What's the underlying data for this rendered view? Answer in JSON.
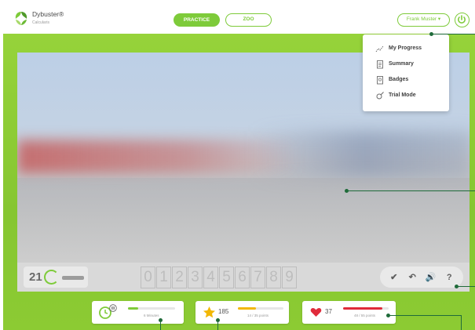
{
  "header": {
    "brand": "Dybuster®",
    "brand_sub": "Calcularis",
    "tabs": [
      {
        "label": "PRACTICE",
        "active": true
      },
      {
        "label": "ZOO",
        "active": false
      }
    ],
    "user_label": "Frank Muster ▾",
    "icons": {
      "logo": "dybuster-logo-icon",
      "power": "power-icon"
    }
  },
  "menu": {
    "items": [
      {
        "label": "My Progress",
        "icon": "chart-line-icon"
      },
      {
        "label": "Summary",
        "icon": "clipboard-icon"
      },
      {
        "label": "Badges",
        "icon": "badge-clipboard-icon"
      },
      {
        "label": "Trial Mode",
        "icon": "wrench-gear-icon"
      }
    ]
  },
  "toolbar": {
    "counter": "21",
    "digits": [
      "0",
      "1",
      "2",
      "3",
      "4",
      "5",
      "6",
      "7",
      "8",
      "9"
    ],
    "tools": [
      {
        "glyph": "✔",
        "icon": "check-icon"
      },
      {
        "glyph": "↶",
        "icon": "undo-icon"
      },
      {
        "glyph": "🔊",
        "icon": "speaker-icon"
      },
      {
        "glyph": "?",
        "icon": "help-icon"
      }
    ]
  },
  "stats": {
    "time": {
      "label": "6 Minutes"
    },
    "stars": {
      "value": "185",
      "label": "14 / 35 points",
      "progress": 0.4
    },
    "hearts": {
      "value": "37",
      "label": "48 / 55 points",
      "progress": 0.87
    }
  },
  "colors": {
    "accent_green": "#7ecb3a",
    "frame_green": "#8ccb33",
    "callout": "#1f6b3a",
    "star_yellow": "#f2b705",
    "heart_red": "#e02b3b"
  }
}
